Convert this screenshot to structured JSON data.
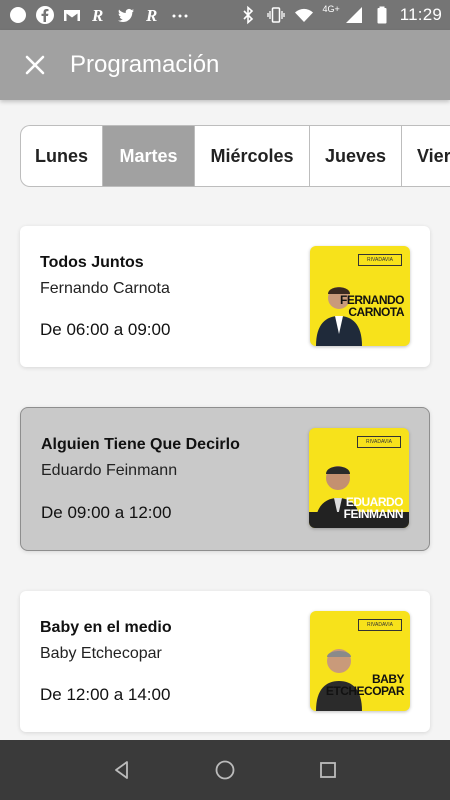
{
  "status_bar": {
    "time": "11:29",
    "network": "4G+",
    "icons": [
      "circle-icon",
      "facebook-icon",
      "gmail-icon",
      "r-app-icon",
      "twitter-icon",
      "r-app-icon",
      "more-icon",
      "bluetooth-icon",
      "vibrate-icon",
      "wifi-icon",
      "signal-icon",
      "battery-icon"
    ]
  },
  "app_bar": {
    "title": "Programación",
    "close_icon": "close-icon"
  },
  "tabs": [
    {
      "label": "Lunes",
      "active": false
    },
    {
      "label": "Martes",
      "active": true
    },
    {
      "label": "Miércoles",
      "active": false
    },
    {
      "label": "Jueves",
      "active": false
    },
    {
      "label": "Viernes",
      "active": false
    }
  ],
  "programs": [
    {
      "show": "Todos Juntos",
      "host": "Fernando Carnota",
      "time": "De 06:00 a 09:00",
      "selected": false,
      "thumb_name": [
        "FERNANDO",
        "CARNOTA"
      ]
    },
    {
      "show": "Alguien Tiene Que Decirlo",
      "host": "Eduardo Feinmann",
      "time": "De 09:00 a 12:00",
      "selected": true,
      "thumb_name": [
        "EDUARDO",
        "FEINMANN"
      ]
    },
    {
      "show": "Baby en el medio",
      "host": "Baby Etchecopar",
      "time": "De 12:00 a 14:00",
      "selected": false,
      "thumb_name": [
        "BABY",
        "ETCHECOPAR"
      ]
    }
  ],
  "colors": {
    "app_bar": "#a1a1a1",
    "status_bar": "#757575",
    "accent_yellow": "#f7e21b",
    "nav_bar": "#3a3a3a"
  },
  "nav": {
    "back_icon": "back-icon",
    "home_icon": "home-icon",
    "recents_icon": "recents-icon"
  }
}
